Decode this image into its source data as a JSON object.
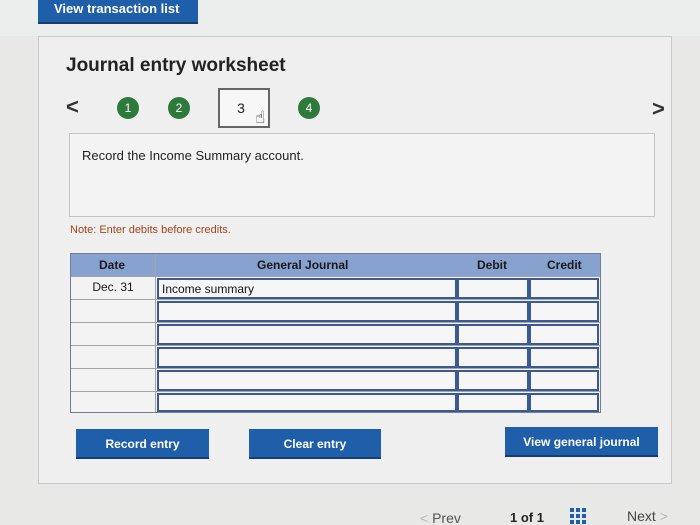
{
  "header": {
    "view_transaction_list": "View transaction list"
  },
  "worksheet": {
    "title": "Journal entry worksheet",
    "nav_prev_glyph": "<",
    "nav_next_glyph": ">",
    "steps": [
      {
        "label": "1",
        "state": "complete"
      },
      {
        "label": "2",
        "state": "complete"
      },
      {
        "label": "3",
        "state": "current"
      },
      {
        "label": "4",
        "state": "complete"
      }
    ],
    "instruction": "Record the Income Summary account.",
    "note": "Note: Enter debits before credits."
  },
  "table": {
    "headers": {
      "date": "Date",
      "journal": "General Journal",
      "debit": "Debit",
      "credit": "Credit"
    },
    "rows": [
      {
        "date": "Dec. 31",
        "journal": "Income summary",
        "debit": "",
        "credit": ""
      },
      {
        "date": "",
        "journal": "",
        "debit": "",
        "credit": ""
      },
      {
        "date": "",
        "journal": "",
        "debit": "",
        "credit": ""
      },
      {
        "date": "",
        "journal": "",
        "debit": "",
        "credit": ""
      },
      {
        "date": "",
        "journal": "",
        "debit": "",
        "credit": ""
      },
      {
        "date": "",
        "journal": "",
        "debit": "",
        "credit": ""
      }
    ]
  },
  "buttons": {
    "record_entry": "Record entry",
    "clear_entry": "Clear entry",
    "view_general_journal": "View general journal"
  },
  "pager": {
    "prev_glyph": "<",
    "prev": "Prev",
    "count": "1 of 1",
    "next": "Next",
    "next_glyph": ">"
  },
  "colors": {
    "button_blue": "#1f5ea8",
    "step_green": "#2d7a3a",
    "table_header": "#87a2cf",
    "note_orange": "#a0461a"
  },
  "icons": {
    "grid": "grid-icon",
    "hand": "hand-pointer-icon"
  }
}
